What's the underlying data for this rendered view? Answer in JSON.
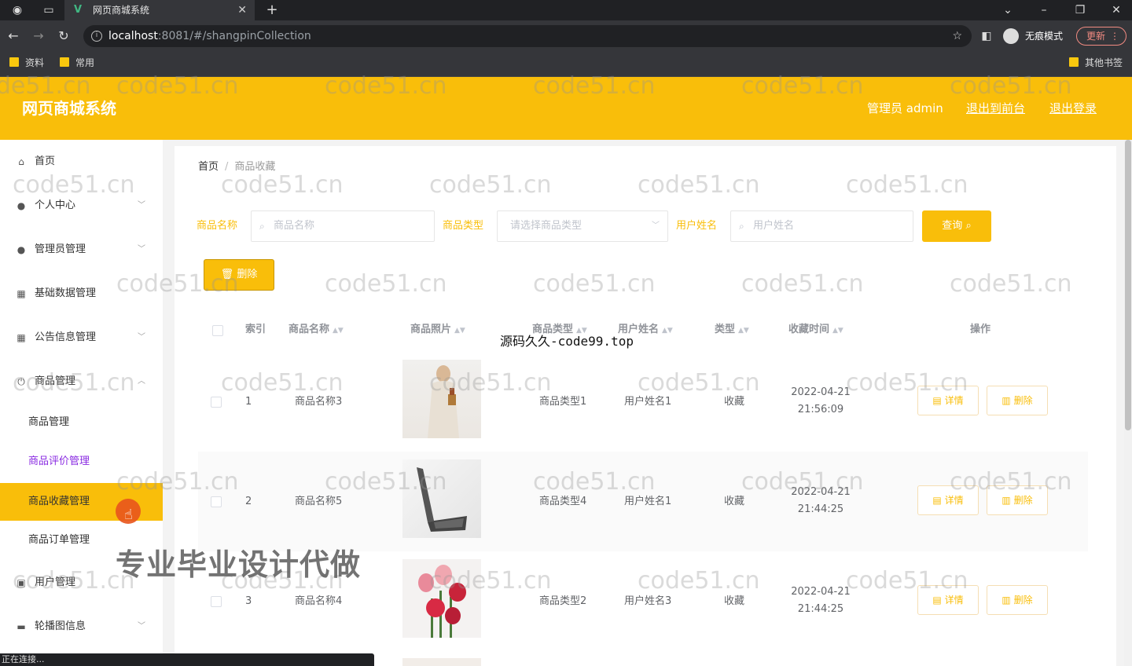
{
  "browser": {
    "tab_title": "网页商城系统",
    "url_host": "localhost",
    "url_path": ":8081/#/shangpinCollection",
    "incognito_label": "无痕模式",
    "update_label": "更新",
    "bookmarks": [
      "资料",
      "常用"
    ],
    "other_bookmarks": "其他书签",
    "status_text": "正在连接..."
  },
  "header": {
    "title": "网页商城系统",
    "admin_label": "管理员 admin",
    "front_link": "退出到前台",
    "logout_link": "退出登录"
  },
  "sidebar": {
    "items": [
      {
        "label": "首页",
        "icon": "home-icon"
      },
      {
        "label": "个人中心",
        "icon": "user-icon"
      },
      {
        "label": "管理员管理",
        "icon": "admin-icon"
      },
      {
        "label": "基础数据管理",
        "icon": "grid-icon"
      },
      {
        "label": "公告信息管理",
        "icon": "apps-icon"
      },
      {
        "label": "商品管理",
        "icon": "power-icon"
      },
      {
        "label": "用户管理",
        "icon": "users-icon"
      },
      {
        "label": "轮播图信息",
        "icon": "carousel-icon"
      }
    ],
    "sub_items": [
      "商品管理",
      "商品评价管理",
      "商品收藏管理",
      "商品订单管理"
    ]
  },
  "breadcrumb": {
    "home": "首页",
    "current": "商品收藏"
  },
  "filters": {
    "name_label": "商品名称",
    "name_placeholder": "商品名称",
    "type_label": "商品类型",
    "type_placeholder": "请选择商品类型",
    "user_label": "用户姓名",
    "user_placeholder": "用户姓名",
    "query_label": "查询"
  },
  "toolbar": {
    "delete_label": "删除"
  },
  "table": {
    "headers": {
      "index": "索引",
      "name": "商品名称",
      "photo": "商品照片",
      "type": "商品类型",
      "user": "用户姓名",
      "kind": "类型",
      "time": "收藏时间",
      "ops": "操作"
    },
    "rows": [
      {
        "index": "1",
        "name": "商品名称3",
        "type": "商品类型1",
        "user": "用户姓名1",
        "kind": "收藏",
        "date": "2022-04-21",
        "time": "21:56:09"
      },
      {
        "index": "2",
        "name": "商品名称5",
        "type": "商品类型4",
        "user": "用户姓名1",
        "kind": "收藏",
        "date": "2022-04-21",
        "time": "21:44:25"
      },
      {
        "index": "3",
        "name": "商品名称4",
        "type": "商品类型2",
        "user": "用户姓名3",
        "kind": "收藏",
        "date": "2022-04-21",
        "time": "21:44:25"
      }
    ],
    "detail_label": "详情",
    "row_delete_label": "删除"
  },
  "overlays": {
    "watermark": "code51.cn",
    "source_text": "源码久久-code99.top",
    "promo_text": "专业毕业设计代做"
  }
}
